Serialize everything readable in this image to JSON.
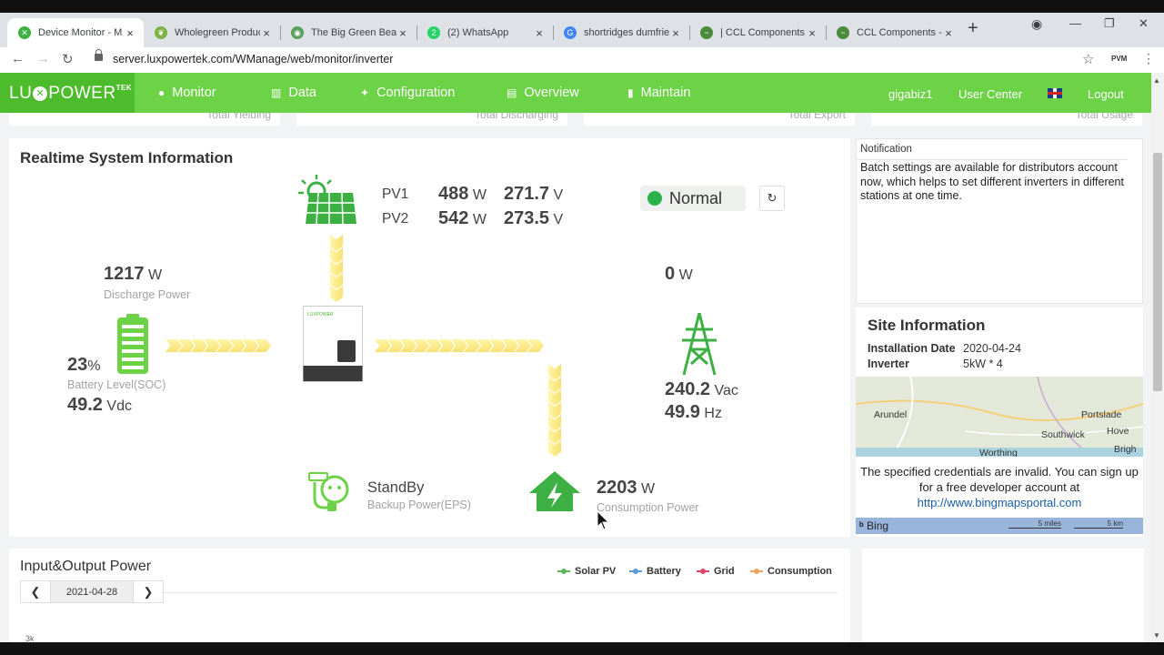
{
  "browser": {
    "tabs": [
      {
        "title": "Device Monitor - M",
        "color": "#3cb043",
        "glyph": "✕"
      },
      {
        "title": "Wholegreen Produc",
        "color": "#7cb342",
        "glyph": "❦"
      },
      {
        "title": "The Big Green Bear",
        "color": "#5aa05a",
        "glyph": "◉"
      },
      {
        "title": "(2) WhatsApp",
        "color": "#25d366",
        "glyph": "2"
      },
      {
        "title": "shortridges dumfrie",
        "color": "#4285f4",
        "glyph": "G"
      },
      {
        "title": "| CCL Components",
        "color": "#4b8b3b",
        "glyph": "~"
      },
      {
        "title": "CCL Components - (",
        "color": "#4b8b3b",
        "glyph": "~"
      }
    ],
    "url": "server.luxpowertek.com/WManage/web/monitor/inverter",
    "ext_label": "PVM"
  },
  "nav": {
    "logo": "LU",
    "logo_x": "✕",
    "logo_rest": "POWER",
    "logo_sup": "TEK",
    "items": [
      {
        "label": "Monitor",
        "icon": "●"
      },
      {
        "label": "Data",
        "icon": "▥"
      },
      {
        "label": "Configuration",
        "icon": "✦"
      },
      {
        "label": "Overview",
        "icon": "▤"
      },
      {
        "label": "Maintain",
        "icon": "▮"
      }
    ],
    "user": "gigabiz1",
    "user_center": "User Center",
    "logout": "Logout"
  },
  "stubs": [
    "Total Yielding",
    "Total Discharging",
    "Total Export",
    "Total Usage"
  ],
  "realtime": {
    "title": "Realtime System Information",
    "pv1_label": "PV1",
    "pv1_power": "488",
    "pv1_voltage": "271.7",
    "pv2_label": "PV2",
    "pv2_power": "542",
    "pv2_voltage": "273.5",
    "unit_w": "W",
    "unit_v": "V",
    "status": "Normal",
    "battery_power": "1217",
    "battery_power_label": "Discharge Power",
    "soc": "23",
    "soc_unit": "%",
    "soc_label": "Battery Level(SOC)",
    "battery_voltage": "49.2",
    "battery_voltage_unit": "Vdc",
    "grid_power": "0",
    "grid_voltage": "240.2",
    "grid_voltage_unit": "Vac",
    "grid_freq": "49.9",
    "grid_freq_unit": "Hz",
    "eps_status": "StandBy",
    "eps_label": "Backup Power(EPS)",
    "consumption_power": "2203",
    "consumption_label": "Consumption Power",
    "inverter_brand": "LUXPOWER"
  },
  "notification": {
    "heading": "Notification",
    "body": "Batch settings are available for distributors account now, which helps to set different inverters in different stations at one time."
  },
  "site": {
    "title": "Site Information",
    "install_label": "Installation Date",
    "install_value": "2020-04-24",
    "inverter_label": "Inverter",
    "inverter_value": "5kW * 4",
    "map_labels": [
      "Arundel",
      "Portslade",
      "Hove",
      "Southwick",
      "Brigh",
      "Worthing"
    ],
    "map_error": "The specified credentials are invalid. You can sign up for a free developer account at",
    "map_link": "http://www.bingmapsportal.com",
    "bing": "Bing",
    "scale_miles": "5 miles",
    "scale_km": "5 km"
  },
  "io": {
    "title": "Input&Output Power",
    "date": "2021-04-28",
    "y_tick": "3k",
    "legend": [
      {
        "name": "Solar PV",
        "color": "#5cb85c"
      },
      {
        "name": "Battery",
        "color": "#5b9bd5"
      },
      {
        "name": "Grid",
        "color": "#e0436b"
      },
      {
        "name": "Consumption",
        "color": "#f0a35e"
      }
    ]
  }
}
